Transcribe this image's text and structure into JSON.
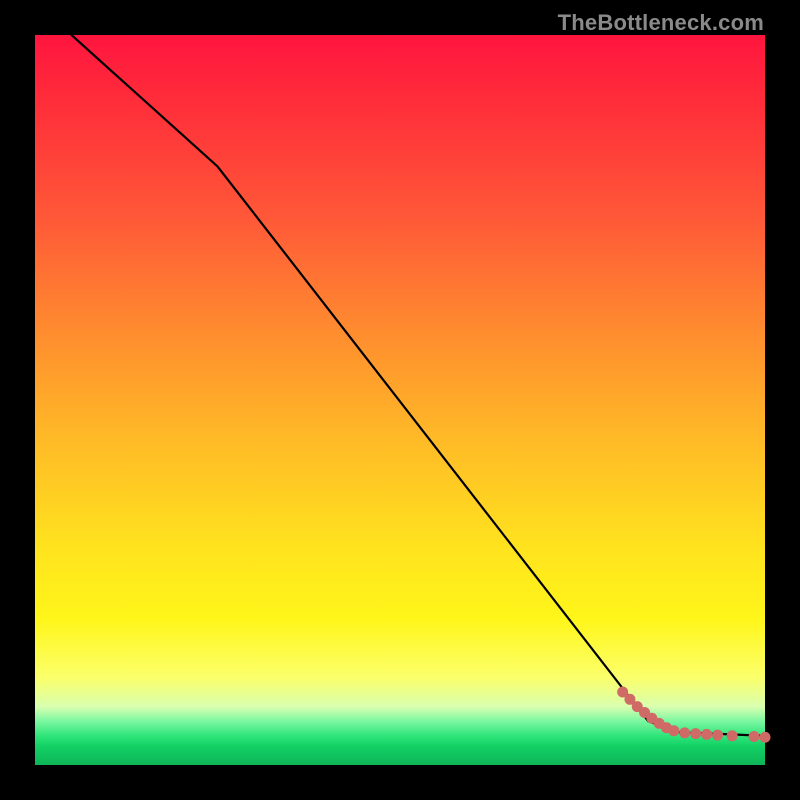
{
  "watermark": "TheBottleneck.com",
  "colors": {
    "marker": "#cf6a66",
    "line": "#000000"
  },
  "chart_data": {
    "type": "line",
    "title": "",
    "xlabel": "",
    "ylabel": "",
    "xlim": [
      0,
      100
    ],
    "ylim": [
      0,
      100
    ],
    "grid": false,
    "note": "No axis tick labels are visible; values are read as percentage of plot-area width/height. Y is measured from bottom.",
    "curve": [
      {
        "x": 5,
        "y": 100
      },
      {
        "x": 25,
        "y": 82
      },
      {
        "x": 84,
        "y": 6
      },
      {
        "x": 88,
        "y": 4.5
      },
      {
        "x": 100,
        "y": 4
      }
    ],
    "scatter_points": [
      {
        "x": 80.5,
        "y": 10.0
      },
      {
        "x": 81.5,
        "y": 9.0
      },
      {
        "x": 82.5,
        "y": 8.0
      },
      {
        "x": 83.5,
        "y": 7.2
      },
      {
        "x": 84.5,
        "y": 6.4
      },
      {
        "x": 85.5,
        "y": 5.7
      },
      {
        "x": 86.5,
        "y": 5.1
      },
      {
        "x": 87.5,
        "y": 4.7
      },
      {
        "x": 89.0,
        "y": 4.4
      },
      {
        "x": 90.5,
        "y": 4.3
      },
      {
        "x": 92.0,
        "y": 4.2
      },
      {
        "x": 93.5,
        "y": 4.1
      },
      {
        "x": 95.5,
        "y": 4.0
      },
      {
        "x": 98.5,
        "y": 3.9
      },
      {
        "x": 100.0,
        "y": 3.8
      }
    ]
  }
}
